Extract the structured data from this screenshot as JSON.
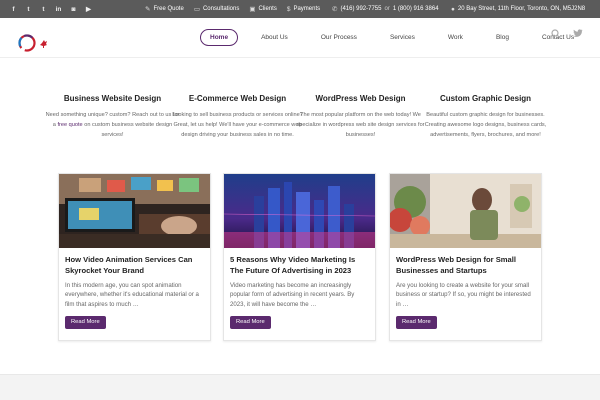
{
  "topbar": {
    "social": [
      {
        "name": "facebook-icon",
        "glyph": "f"
      },
      {
        "name": "twitter-icon",
        "glyph": "t"
      },
      {
        "name": "tumblr-icon",
        "glyph": "t"
      },
      {
        "name": "linkedin-icon",
        "glyph": "in"
      },
      {
        "name": "instagram-icon",
        "glyph": "◙"
      },
      {
        "name": "youtube-icon",
        "glyph": "▶"
      }
    ],
    "links": {
      "free_quote": "Free Quote",
      "consultations": "Consultations",
      "clients": "Clients",
      "payments": "Payments"
    },
    "phone": "(416) 992-7755",
    "phone_or": "or",
    "phone2": "1 (800) 916 3864",
    "address": "20 Bay Street, 11th Floor, Toronto, ON, M5J2N8"
  },
  "nav": {
    "items": [
      "Home",
      "About Us",
      "Our Process",
      "Services",
      "Work",
      "Blog",
      "Contact Us"
    ],
    "active": "Home"
  },
  "services": [
    {
      "title": "Business Website Design",
      "text_pre": "Need something unique? custom? Reach out to us for a ",
      "link": "free quote",
      "text_post": " on custom business website design services!"
    },
    {
      "title": "E-Commerce Web Design",
      "text": "Looking to sell business products or services online? Great, let us help! We'll have your e-commerce web design driving your business sales in no time."
    },
    {
      "title": "WordPress Web Design",
      "text": "The most popular platform on the web today! We specialize in wordpress web site design services for businesses!"
    },
    {
      "title": "Custom Graphic Design",
      "text": "Beautiful custom graphic design for businesses. Creating awesome logo designs, business cards, advertisements, flyers, brochures, and more!"
    }
  ],
  "posts": [
    {
      "title": "How Video Animation Services Can Skyrocket Your Brand",
      "excerpt": "In this modern age, you can spot animation everywhere, whether it's educational material or a film that aspires to much …",
      "button": "Read More"
    },
    {
      "title": "5 Reasons Why Video Marketing Is The Future Of Advertising in 2023",
      "excerpt": "Video marketing has become an increasingly popular form of advertising in recent years. By 2023, it will have become the …",
      "button": "Read More"
    },
    {
      "title": "WordPress Web Design for Small Businesses and Startups",
      "excerpt": "Are you looking to create a website for your small business or startup? If so, you might be interested in …",
      "button": "Read More"
    }
  ],
  "colors": {
    "brand": "#5b2a6e",
    "topbar": "#5b5b5b"
  }
}
